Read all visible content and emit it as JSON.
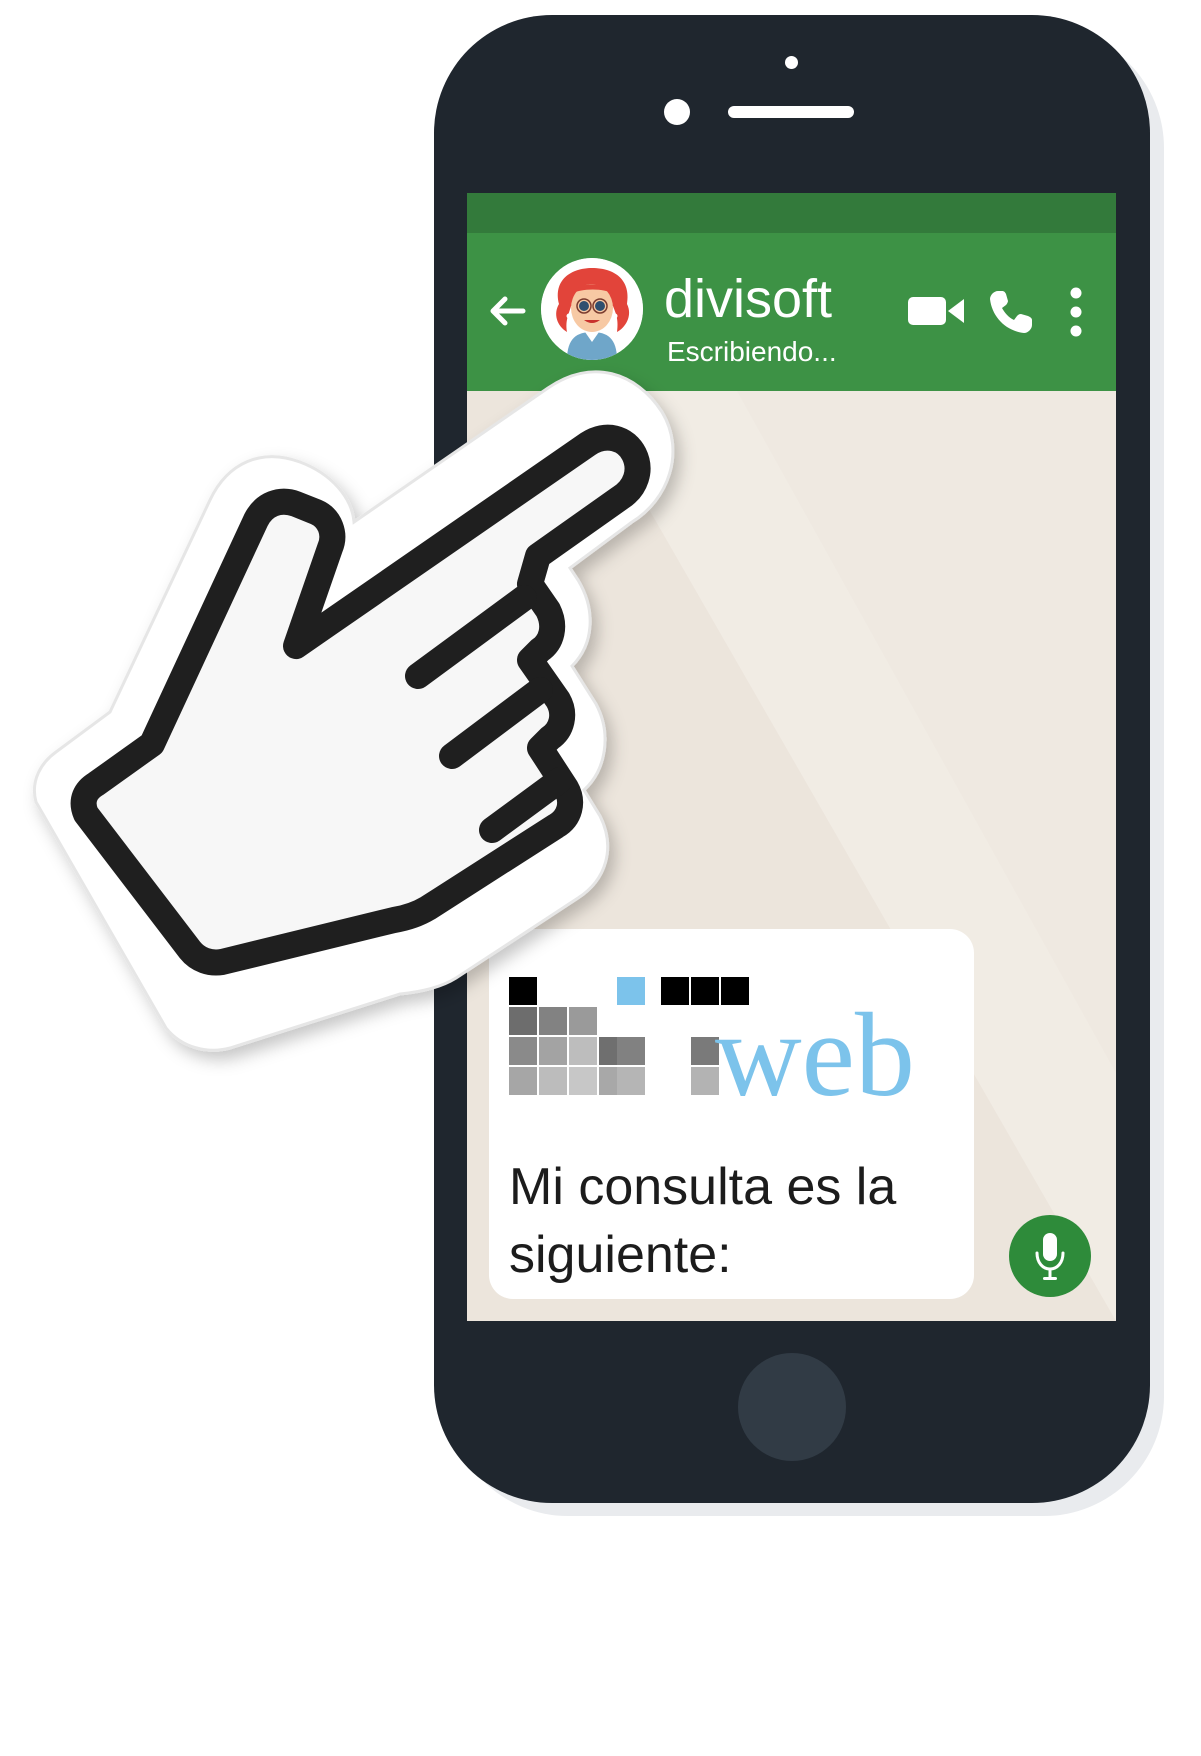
{
  "chat_header": {
    "contact_name": "divisoft",
    "contact_status": "Escribiendo..."
  },
  "message": {
    "text": "Mi consulta es la siguiente:",
    "logo_text": "biteweb"
  },
  "icons": {
    "back": "arrow-left-icon",
    "video": "video-camera-icon",
    "call": "phone-icon",
    "menu": "more-vertical-icon",
    "mic": "microphone-icon",
    "pointer": "pointing-hand-icon"
  },
  "colors": {
    "header": "#3d9245",
    "status_bar": "#337a3b",
    "chat_background": "#efe9e1",
    "phone_body": "#1f262e",
    "mic_button": "#2e8b3a",
    "logo_blue": "#7cc3eb"
  }
}
